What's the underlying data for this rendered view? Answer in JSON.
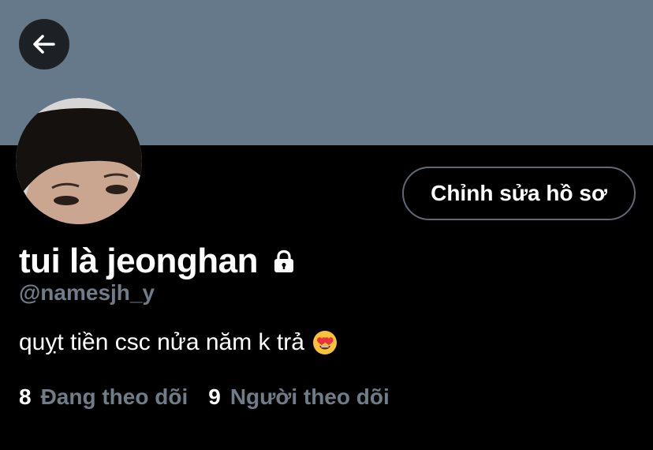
{
  "profile": {
    "display_name": "tui là jeonghan",
    "handle": "@namesjh_y",
    "bio": "quỵt tiền csc nửa năm k trả",
    "bio_emoji": "smiling-face-with-heart-eyes",
    "protected": true
  },
  "actions": {
    "edit_profile_label": "Chỉnh sửa hồ sơ",
    "back_icon": "arrow-left-icon"
  },
  "stats": {
    "following_count": "8",
    "following_label": "Đang theo dõi",
    "followers_count": "9",
    "followers_label": "Người theo dõi"
  },
  "colors": {
    "banner": "#66798a",
    "background": "#000000",
    "muted_text": "#707c88",
    "button_border": "#5e6b76"
  }
}
